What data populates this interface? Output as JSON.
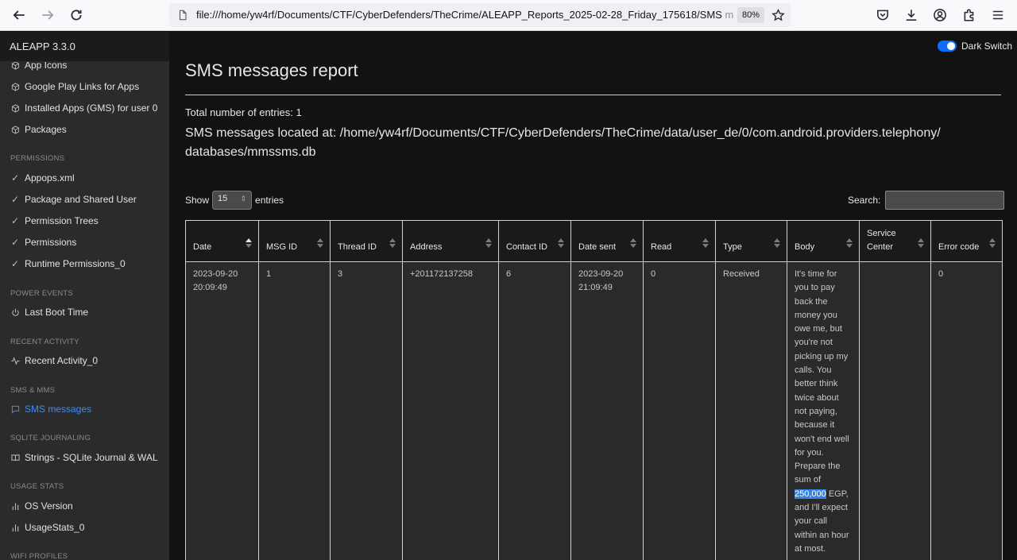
{
  "browser": {
    "url_main": "file:///home/yw4rf/Documents/CTF/CyberDefenders/TheCrime/ALEAPP_Reports_2025-02-28_Friday_175618/SMS",
    "url_fade": " m",
    "zoom": "80%"
  },
  "app": {
    "brand": "ALEAPP 3.3.0",
    "dark_switch_label": "Dark Switch"
  },
  "sidebar": {
    "items_top": [
      {
        "label": "App Icons"
      },
      {
        "label": "Google Play Links for Apps"
      },
      {
        "label": "Installed Apps (GMS) for user 0"
      },
      {
        "label": "Packages"
      }
    ],
    "sections": [
      {
        "heading": "PERMISSIONS",
        "items": [
          "Appops.xml",
          "Package and Shared User",
          "Permission Trees",
          "Permissions",
          "Runtime Permissions_0"
        ]
      },
      {
        "heading": "POWER EVENTS",
        "items": [
          "Last Boot Time"
        ]
      },
      {
        "heading": "RECENT ACTIVITY",
        "items": [
          "Recent Activity_0"
        ]
      },
      {
        "heading": "SMS & MMS",
        "items": [
          "SMS messages"
        ]
      },
      {
        "heading": "SQLITE JOURNALING",
        "items": [
          "Strings - SQLite Journal & WAL"
        ]
      },
      {
        "heading": "USAGE STATS",
        "items": [
          "OS Version",
          "UsageStats_0"
        ]
      },
      {
        "heading": "WIFI PROFILES",
        "items": []
      }
    ]
  },
  "report": {
    "title": "SMS messages report",
    "total": "Total number of entries: 1",
    "location_line1": "SMS messages located at: /home/yw4rf/Documents/CTF/CyberDefenders/TheCrime/data/user_de/0/com.android.providers.telephony/",
    "location_line2": "databases/mmssms.db",
    "show_label": "Show",
    "show_value": "15",
    "entries_label": "entries",
    "search_label": "Search:"
  },
  "table": {
    "headers": [
      "Date",
      "MSG ID",
      "Thread ID",
      "Address",
      "Contact ID",
      "Date sent",
      "Read",
      "Type",
      "Body",
      "Service Center",
      "Error code"
    ],
    "row": {
      "date": "2023-09-20 20:09:49",
      "msg_id": "1",
      "thread_id": "3",
      "address": "+201172137258",
      "contact_id": "6",
      "date_sent": "2023-09-20 21:09:49",
      "read": "0",
      "type": "Received",
      "body_before": "It's time for you to pay back the money you owe me, but you're not picking up my calls. You better think twice about not paying, because it won't end well for you. Prepare the sum of ",
      "body_highlight": "250,000",
      "body_after": " EGP, and I'll expect your call within an hour at most.",
      "service_center": "",
      "error_code": "0"
    }
  }
}
